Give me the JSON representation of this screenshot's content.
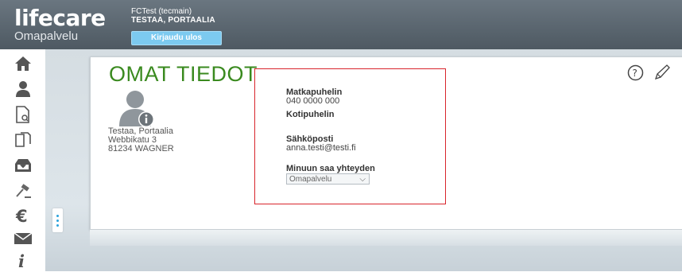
{
  "header": {
    "logo_main": "lifecare",
    "logo_sub": "Omapalvelu",
    "user_name": "FCTest (tecmain)",
    "user_org": "TESTAA, PORTAALIA",
    "logout_label": "Kirjaudu ulos"
  },
  "sidebar": {
    "items": [
      {
        "icon": "home-icon"
      },
      {
        "icon": "user-icon"
      },
      {
        "icon": "document-search-icon"
      },
      {
        "icon": "documents-icon"
      },
      {
        "icon": "inbox-download-icon"
      },
      {
        "icon": "gavel-icon"
      },
      {
        "icon": "euro-icon"
      },
      {
        "icon": "mail-icon"
      },
      {
        "icon": "info-icon"
      }
    ]
  },
  "panel": {
    "title": "OMAT TIEDOT",
    "person": {
      "name": "Testaa, Portaalia",
      "street": "Webbikatu 3",
      "city": "81234 WAGNER"
    },
    "fields": {
      "mobile_label": "Matkapuhelin",
      "mobile_value": "040 0000 000",
      "home_phone_label": "Kotipuhelin",
      "email_label": "Sähköposti",
      "email_value": "anna.testi@testi.fi",
      "contact_label": "Minuun saa yhteyden",
      "contact_value": "Omapalvelu"
    }
  },
  "colors": {
    "header_bg": "#5b6670",
    "title_green": "#3a8a1f",
    "logout_blue": "#7ccaf0",
    "highlight_red": "#d8242c"
  }
}
